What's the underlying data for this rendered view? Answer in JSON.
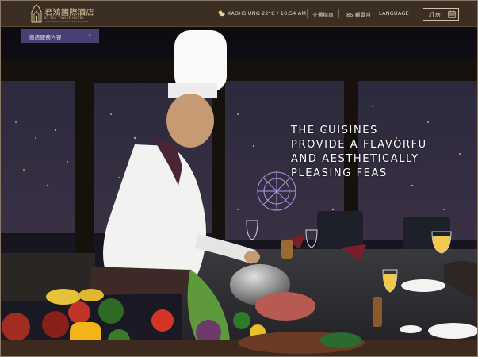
{
  "header": {
    "logo": {
      "name_cn": "君鴻國際酒店",
      "name_en": "85 SKY TOWER HOTEL",
      "tagline_en": "THE LANDMARK OF KAOHSIUNG"
    },
    "location": "KAOHSIUNG",
    "weather": "22°C / 10:54 AM",
    "weather_icon": "partly-cloudy-icon",
    "traffic_guide": "交通指南",
    "observatory": "85 觀景台",
    "language": "LANGUAGE",
    "book_label": "訂房",
    "book_icon": "calendar-icon"
  },
  "hotel_guide": {
    "label": "飯店服務內容",
    "chevron": "⌄"
  },
  "hero": {
    "tagline_lines": [
      "THE CUISINES",
      "PROVIDE A FLAVORFU",
      "AND AESTHETICALLY",
      "PLEASING FEAS"
    ]
  },
  "colors": {
    "header_bg": "#3b2e22",
    "gold": "#d8c39a",
    "guide_bg": "#4a3f73"
  }
}
